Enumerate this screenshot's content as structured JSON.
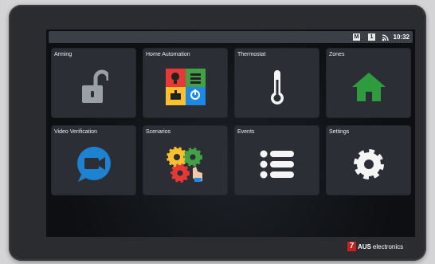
{
  "status": {
    "chip1": "M",
    "chip2": "1",
    "time": "10:32",
    "wifi_icon": "wifi-icon"
  },
  "tiles": [
    {
      "label": "Arming",
      "icon": "padlock-open-icon"
    },
    {
      "label": "Home Automation",
      "icon": "home-automation-grid-icon"
    },
    {
      "label": "Thermostat",
      "icon": "thermometer-icon"
    },
    {
      "label": "Zones",
      "icon": "house-icon"
    },
    {
      "label": "Video Verification",
      "icon": "video-camera-icon"
    },
    {
      "label": "Scenarios",
      "icon": "gears-icon"
    },
    {
      "label": "Events",
      "icon": "list-icon"
    },
    {
      "label": "Settings",
      "icon": "gear-icon"
    }
  ],
  "brand": {
    "mark": "7",
    "name": "AUS",
    "suffix": "electronics"
  },
  "colors": {
    "tile_bg": "#2b2e35",
    "zones_green": "#2e9c3e",
    "video_blue": "#1f82d0",
    "lock_gray": "#9aa0a6",
    "brand_red": "#c62020"
  }
}
